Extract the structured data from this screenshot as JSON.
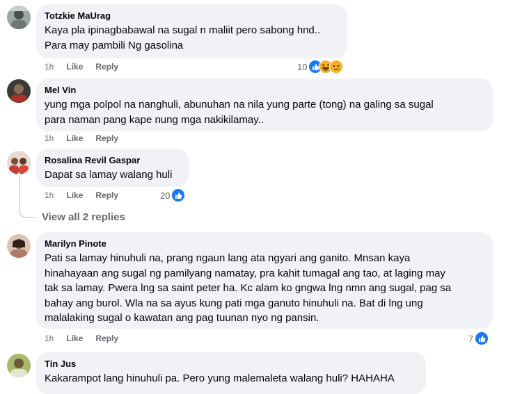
{
  "comments": [
    {
      "author": "Totzkie MaUrag",
      "lines": [
        "Kaya pla ipinagbabawal na sugal n maliit pero sabong hnd..",
        "Para may pambili Ng gasolina"
      ],
      "time": "1h",
      "like": "Like",
      "reply": "Reply",
      "reaction_count": "10",
      "reactions": [
        "like-icon",
        "haha-icon",
        "sad-icon"
      ]
    },
    {
      "author": "Mel Vin",
      "lines": [
        "yung mga polpol na nanghuli, abunuhan na nila yung parte (tong) na galing sa sugal",
        "para naman pang kape nung mga nakikilamay.."
      ],
      "time": "1h",
      "like": "Like",
      "reply": "Reply"
    },
    {
      "author": "Rosalina Revil Gaspar",
      "lines": [
        "Dapat sa lamay walang huli"
      ],
      "time": "1h",
      "like": "Like",
      "reply": "Reply",
      "reaction_count": "20",
      "reactions": [
        "like-icon"
      ],
      "view_replies": "View all 2 replies"
    },
    {
      "author": "Marilyn Pinote",
      "lines": [
        "Pati sa lamay hinuhuli na, prang ngaun lang ata ngyari ang ganito. Mnsan kaya",
        "hinahayaan ang sugal ng pamilyang namatay, pra kahit tumagal ang tao, at laging may",
        "tak sa lamay. Pwera lng sa saint peter ha. Kc alam ko gngwa lng nmn ang sugal, pag sa",
        "bahay ang burol. Wla na sa ayus kung pati mga ganuto hinuhuli na. Bat di lng ung",
        "malalaking sugal o kawatan ang pag tuunan nyo ng pansin."
      ],
      "time": "1h",
      "like": "Like",
      "reply": "Reply",
      "reaction_count": "7",
      "reactions": [
        "like-icon"
      ]
    },
    {
      "author": "Tin Jus",
      "lines": [
        "Kakarampot lang hinuhuli pa. Pero yung malemaleta walang huli? HAHAHA"
      ]
    }
  ],
  "colors": {
    "bubble": "#f0f2f5",
    "meta": "#65676b",
    "like_blue": "#1877f2",
    "haha_yellow": "#f7b125"
  }
}
